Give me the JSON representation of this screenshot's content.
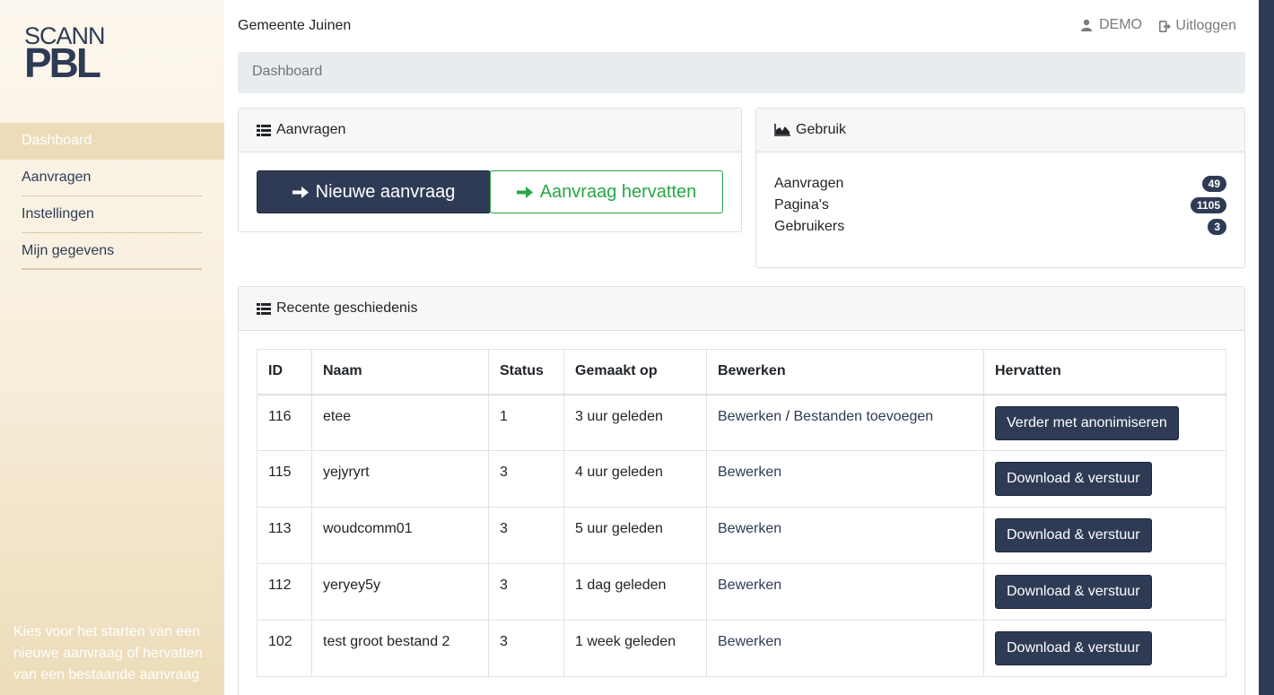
{
  "logo": {
    "line1": "SCANN",
    "line2": "PBL"
  },
  "sidebar": {
    "items": [
      {
        "label": "Dashboard",
        "active": true
      },
      {
        "label": "Aanvragen"
      },
      {
        "label": "Instellingen"
      },
      {
        "label": "Mijn gegevens"
      }
    ],
    "hint": "Kies voor het starten van een nieuwe aanvraag of hervatten van een bestaande aanvraag"
  },
  "header": {
    "organization": "Gemeente Juinen",
    "user": "DEMO",
    "logout": "Uitloggen"
  },
  "breadcrumb": "Dashboard",
  "aanvragen_card": {
    "title": "Aanvragen",
    "new_button": "Nieuwe aanvraag",
    "resume_button": "Aanvraag hervatten"
  },
  "gebruik_card": {
    "title": "Gebruik",
    "rows": [
      {
        "label": "Aanvragen",
        "count": "49"
      },
      {
        "label": "Pagina's",
        "count": "1105"
      },
      {
        "label": "Gebruikers",
        "count": "3"
      }
    ]
  },
  "recent_card": {
    "title": "Recente geschiedenis",
    "columns": [
      "ID",
      "Naam",
      "Status",
      "Gemaakt op",
      "Bewerken",
      "Hervatten"
    ],
    "rows": [
      {
        "id": "116",
        "naam": "etee",
        "status": "1",
        "gemaakt": "3 uur geleden",
        "edit": "Bewerken",
        "sep": " / ",
        "files": "Bestanden toevoegen",
        "action": "Verder met anonimiseren"
      },
      {
        "id": "115",
        "naam": "yejyryrt",
        "status": "3",
        "gemaakt": "4 uur geleden",
        "edit": "Bewerken",
        "action": "Download & verstuur"
      },
      {
        "id": "113",
        "naam": "woudcomm01",
        "status": "3",
        "gemaakt": "5 uur geleden",
        "edit": "Bewerken",
        "action": "Download & verstuur"
      },
      {
        "id": "112",
        "naam": "yeryey5y",
        "status": "3",
        "gemaakt": "1 dag geleden",
        "edit": "Bewerken",
        "action": "Download & verstuur"
      },
      {
        "id": "102",
        "naam": "test groot bestand 2",
        "status": "3",
        "gemaakt": "1 week geleden",
        "edit": "Bewerken",
        "action": "Download & verstuur"
      }
    ]
  },
  "colors": {
    "primary": "#2f3b55",
    "success": "#28a745",
    "sidebar_bg": "#f7edda"
  }
}
